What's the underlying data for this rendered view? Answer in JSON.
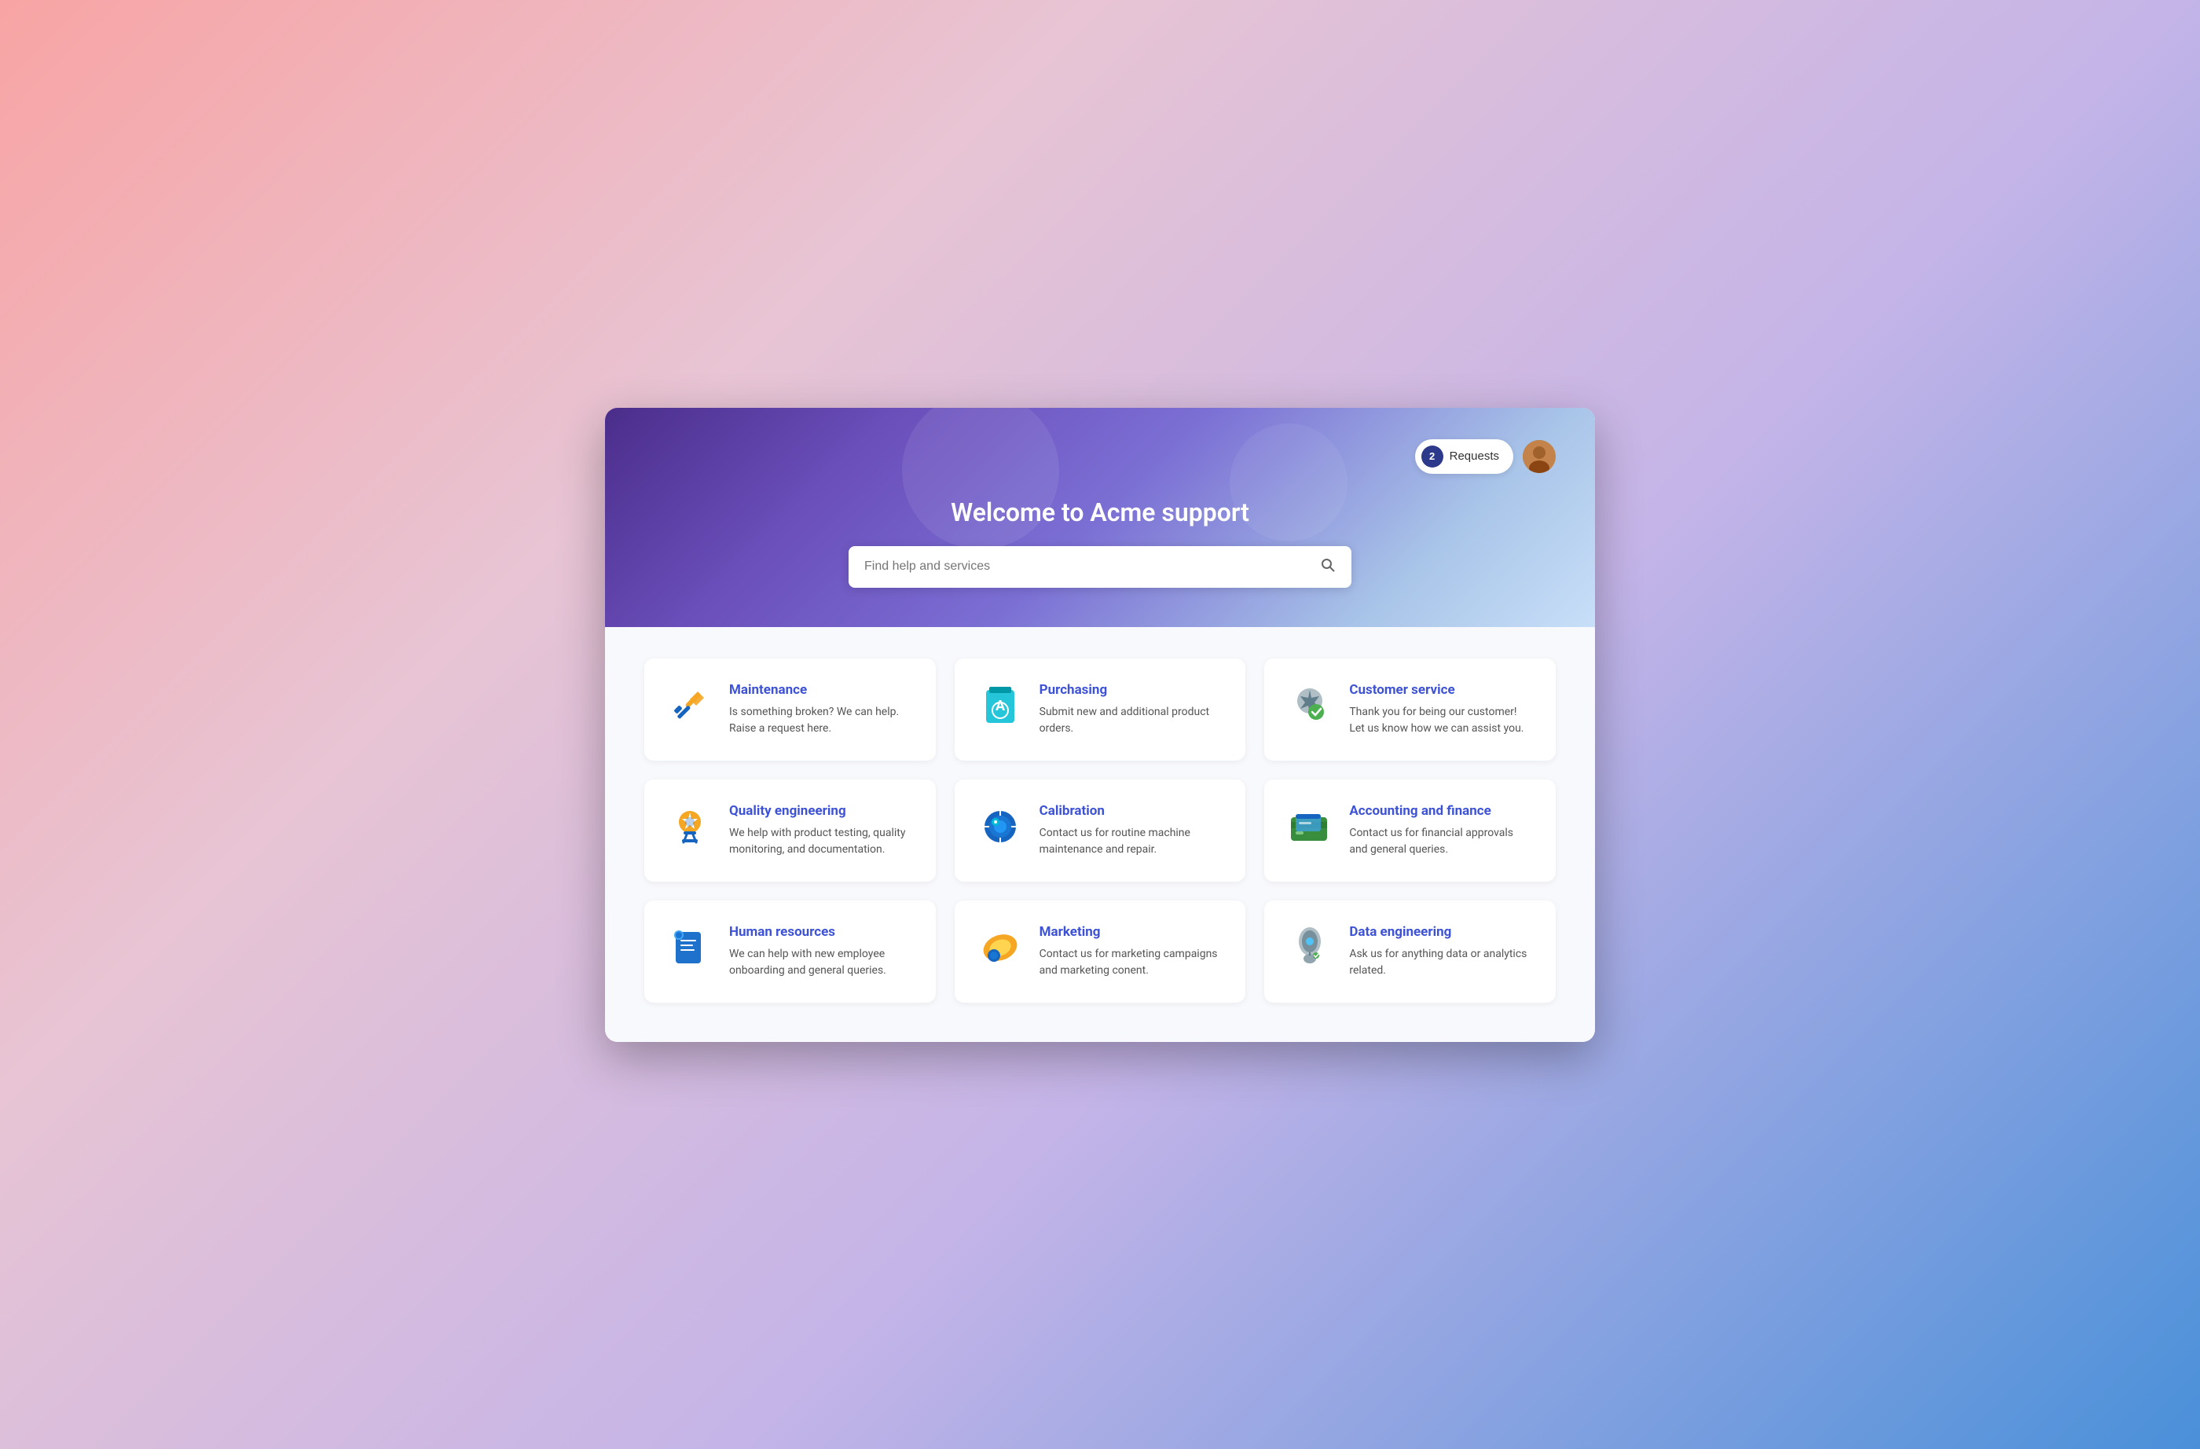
{
  "header": {
    "title": "Welcome to Acme support",
    "requests_badge": "2",
    "requests_label": "Requests",
    "search_placeholder": "Find help and services"
  },
  "services": [
    {
      "id": "maintenance",
      "title": "Maintenance",
      "description": "Is something broken? We can help. Raise a request here.",
      "icon": "maintenance"
    },
    {
      "id": "purchasing",
      "title": "Purchasing",
      "description": "Submit new and additional product orders.",
      "icon": "purchasing"
    },
    {
      "id": "customer-service",
      "title": "Customer service",
      "description": "Thank you for being our customer! Let us know how we can assist you.",
      "icon": "customer-service"
    },
    {
      "id": "quality-engineering",
      "title": "Quality engineering",
      "description": "We help with product testing, quality monitoring, and documentation.",
      "icon": "quality-engineering"
    },
    {
      "id": "calibration",
      "title": "Calibration",
      "description": "Contact us for routine machine maintenance and repair.",
      "icon": "calibration"
    },
    {
      "id": "accounting-finance",
      "title": "Accounting and finance",
      "description": "Contact us for financial approvals and general queries.",
      "icon": "accounting-finance"
    },
    {
      "id": "human-resources",
      "title": "Human resources",
      "description": "We can help with new employee onboarding and general queries.",
      "icon": "human-resources"
    },
    {
      "id": "marketing",
      "title": "Marketing",
      "description": "Contact us for marketing campaigns and marketing conent.",
      "icon": "marketing"
    },
    {
      "id": "data-engineering",
      "title": "Data engineering",
      "description": "Ask us for anything data or analytics related.",
      "icon": "data-engineering"
    }
  ],
  "icons": {
    "maintenance": "🔧",
    "purchasing": "🛍️",
    "customer-service": "🛡️",
    "quality-engineering": "🏅",
    "calibration": "⚙️",
    "accounting-finance": "💳",
    "human-resources": "📋",
    "marketing": "📣",
    "data-engineering": "🔬"
  },
  "icon_colors": {
    "maintenance": "#f5a623",
    "purchasing": "#00bcd4",
    "customer-service": "#90a4ae",
    "quality-engineering": "#f5a623",
    "calibration": "#1565c0",
    "accounting-finance": "#2e7d32",
    "human-resources": "#1565c0",
    "marketing": "#f5a623",
    "data-engineering": "#78909c"
  }
}
